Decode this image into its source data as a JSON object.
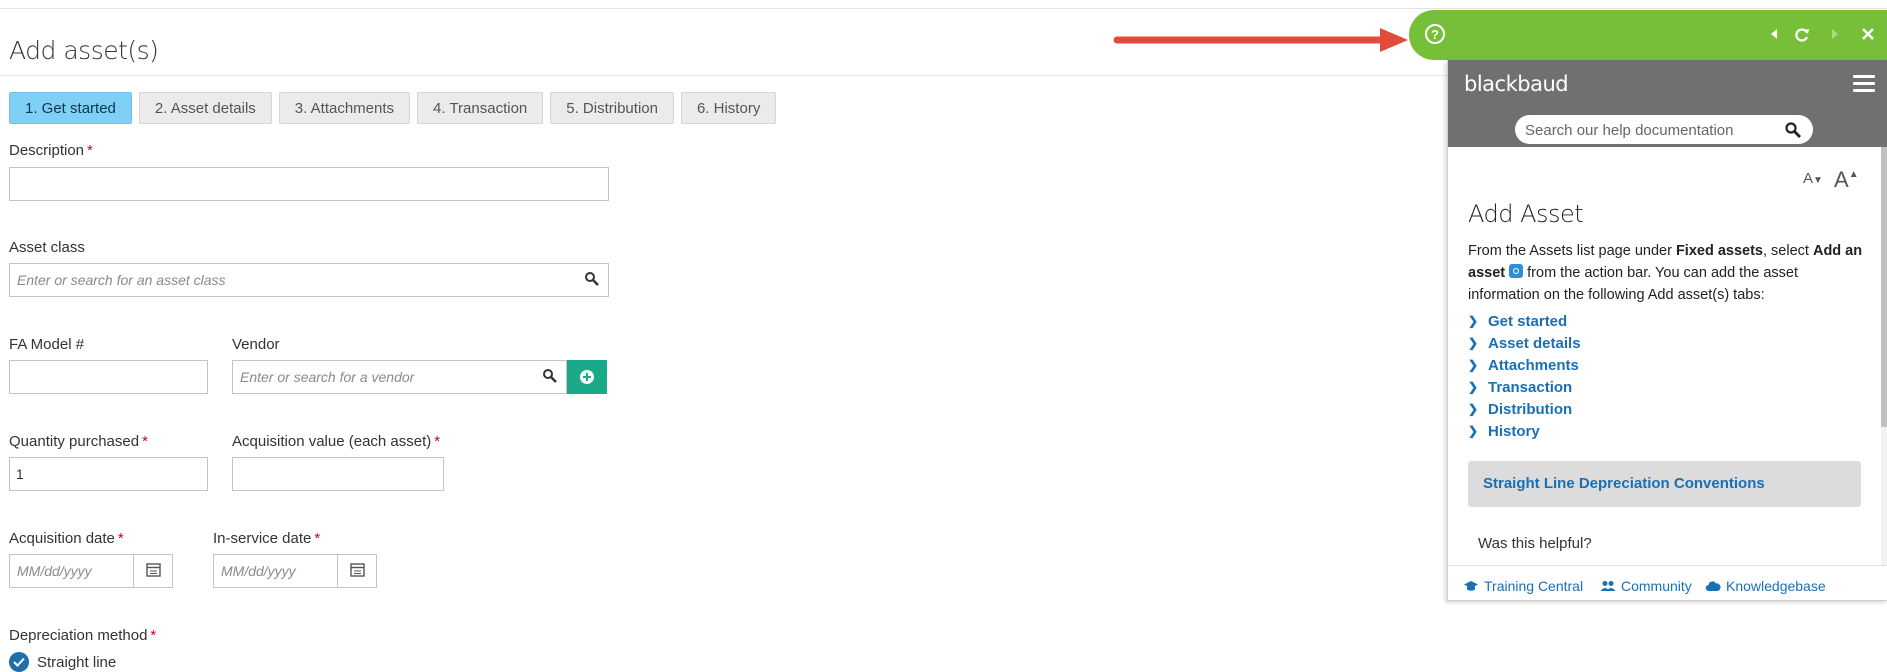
{
  "page": {
    "title": "Add asset(s)"
  },
  "tabs": [
    {
      "label": "1. Get started",
      "active": true
    },
    {
      "label": "2. Asset details"
    },
    {
      "label": "3. Attachments"
    },
    {
      "label": "4. Transaction"
    },
    {
      "label": "5. Distribution"
    },
    {
      "label": "6. History"
    }
  ],
  "form": {
    "description": {
      "label": "Description",
      "required": "*",
      "value": ""
    },
    "asset_class": {
      "label": "Asset class",
      "placeholder": "Enter or search for an asset class"
    },
    "fa_model": {
      "label": "FA Model #",
      "value": ""
    },
    "vendor": {
      "label": "Vendor",
      "placeholder": "Enter or search for a vendor"
    },
    "quantity": {
      "label": "Quantity purchased",
      "required": "*",
      "value": "1"
    },
    "acq_value": {
      "label": "Acquisition value (each asset)",
      "required": "*",
      "value": ""
    },
    "acq_date": {
      "label": "Acquisition date",
      "required": "*",
      "placeholder": "MM/dd/yyyy"
    },
    "service_date": {
      "label": "In-service date",
      "required": "*",
      "placeholder": "MM/dd/yyyy"
    },
    "depreciation": {
      "label": "Depreciation method",
      "required": "*",
      "option": "Straight line"
    }
  },
  "help": {
    "brand": "blackbaud",
    "search_placeholder": "Search our help documentation",
    "font_small": "A",
    "font_large": "A",
    "title": "Add Asset",
    "intro_1": "From the Assets list page under ",
    "intro_bold_1": "Fixed assets",
    "intro_2": ", select ",
    "intro_bold_2": "Add an asset",
    "intro_3": " from the action bar. You can add the asset information on the following Add asset(s) tabs:",
    "links": [
      "Get started",
      "Asset details",
      "Attachments",
      "Transaction",
      "Distribution",
      "History"
    ],
    "related": "Straight Line Depreciation Conventions",
    "helpful": "Was this helpful?",
    "footer": {
      "training": "Training Central",
      "community": "Community",
      "knowledgebase": "Knowledgebase"
    }
  },
  "colors": {
    "active_tab": "#7fd0f4",
    "help_header": "#78bf39",
    "arrow": "#e14b3b",
    "link": "#1a6fb5",
    "add_button": "#1aaa8a"
  }
}
